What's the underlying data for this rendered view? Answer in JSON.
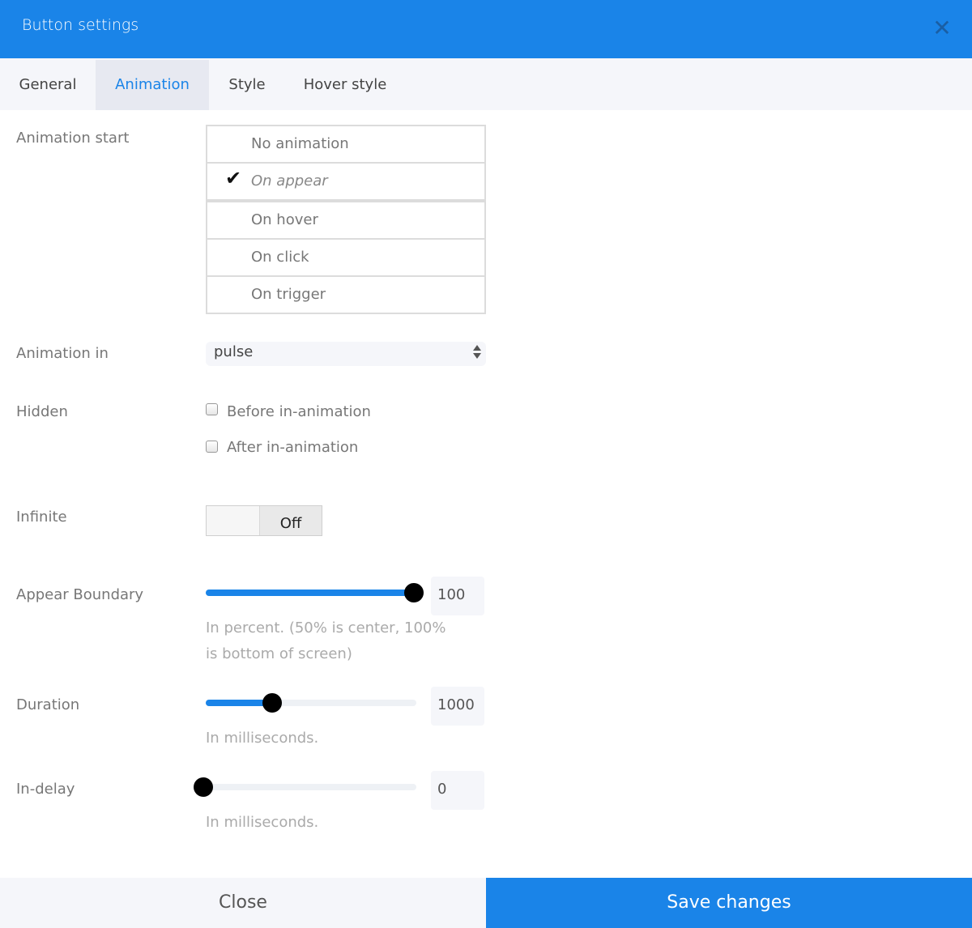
{
  "header": {
    "title": "Button settings",
    "close_icon": "close-icon"
  },
  "tabs": [
    {
      "label": "General"
    },
    {
      "label": "Animation",
      "active": true
    },
    {
      "label": "Style"
    },
    {
      "label": "Hover style"
    }
  ],
  "animation_start": {
    "label": "Animation start",
    "options": [
      "No animation",
      "On appear",
      "On hover",
      "On click",
      "On trigger"
    ],
    "selected": "On appear",
    "check_glyph": "✔"
  },
  "animation_in": {
    "label": "Animation in",
    "value": "pulse"
  },
  "hidden": {
    "label": "Hidden",
    "options": [
      {
        "label": "Before in-animation",
        "checked": false
      },
      {
        "label": "After in-animation",
        "checked": false
      }
    ]
  },
  "infinite": {
    "label": "Infinite",
    "state": "Off"
  },
  "appear_boundary": {
    "label": "Appear Boundary",
    "value": "100",
    "fraction": 1.0,
    "hint": "In percent. (50% is center, 100% is bottom of screen)"
  },
  "duration": {
    "label": "Duration",
    "value": "1000",
    "fraction": 0.325,
    "hint": "In milliseconds."
  },
  "in_delay": {
    "label": "In-delay",
    "value": "0",
    "fraction": 0.0,
    "hint": "In milliseconds."
  },
  "footer": {
    "close_label": "Close",
    "save_label": "Save changes"
  },
  "colors": {
    "accent": "#1a84e8",
    "tab_bar": "#f5f6fa"
  }
}
